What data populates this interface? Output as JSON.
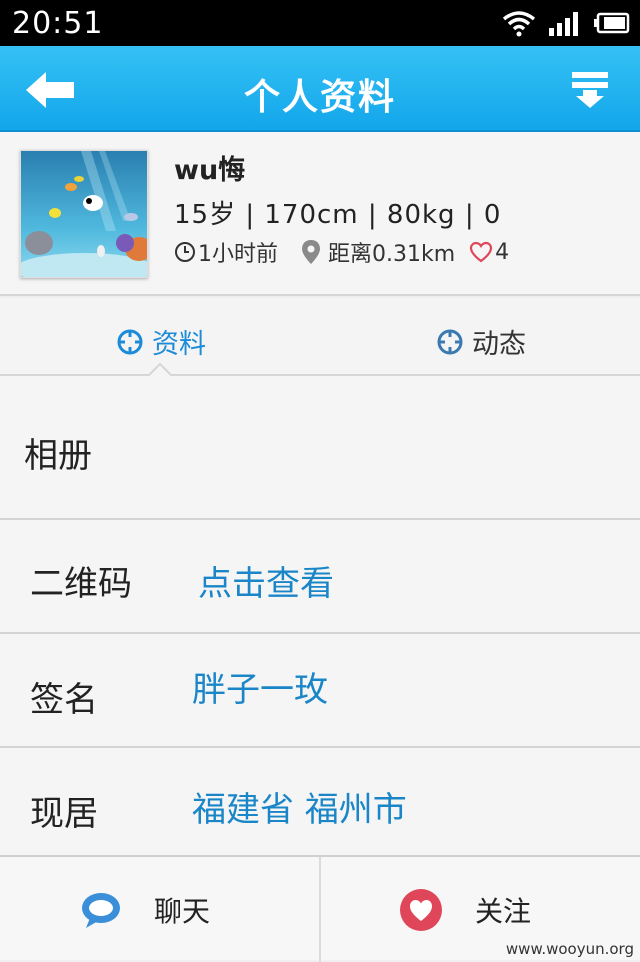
{
  "status_bar": {
    "time": "20:51"
  },
  "header": {
    "title": "个人资料"
  },
  "profile": {
    "name": "wu悔",
    "stats": "15岁  | 170cm  | 80kg  | 0",
    "last_active": "1小时前",
    "distance": "距离0.31km",
    "likes": "4"
  },
  "tabs": [
    {
      "label": "资料",
      "active": true
    },
    {
      "label": "动态",
      "active": false
    }
  ],
  "info_rows": {
    "album": {
      "label": "相册"
    },
    "qrcode": {
      "label": "二维码",
      "value": "点击查看"
    },
    "signature": {
      "label": "签名",
      "value": "胖子一玫"
    },
    "location": {
      "label": "现居",
      "value": "福建省 福州市"
    }
  },
  "bottom_bar": {
    "chat_label": "聊天",
    "follow_label": "关注"
  },
  "watermark": "www.wooyun.org",
  "colors": {
    "accent": "#12a6ea",
    "link": "#1a86c8",
    "heart": "#e0465a",
    "chat": "#3a8fd8"
  }
}
